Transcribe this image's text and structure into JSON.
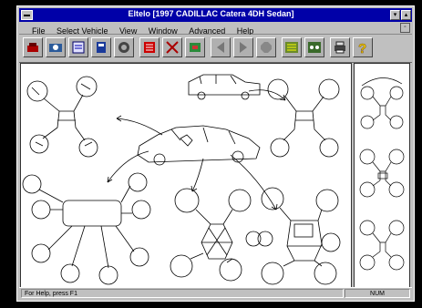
{
  "window": {
    "title": "Eltelo [1997 CADILLAC Catera 4DH Sedan]",
    "controls": {
      "minimize": "▾",
      "maximize": "▴",
      "doc_restore": "▫"
    }
  },
  "menu": [
    "File",
    "Select Vehicle",
    "View",
    "Window",
    "Advanced",
    "Help"
  ],
  "toolbar": {
    "buttons": [
      "vehicle-select-icon",
      "search-icon",
      "notes-icon",
      "book-icon",
      "wheel-icon",
      "document-icon",
      "tools-icon",
      "component-icon",
      "back-icon",
      "forward-icon",
      "stop-icon",
      "diagram-icon",
      "car-icon",
      "printer-icon",
      "help-icon"
    ]
  },
  "status": {
    "help_text": "For Help, press F1",
    "mode": "NUM"
  },
  "colors": {
    "title_bar": "#0000a8",
    "chrome": "#c0c0c0",
    "help_icon": "#f0d000"
  }
}
